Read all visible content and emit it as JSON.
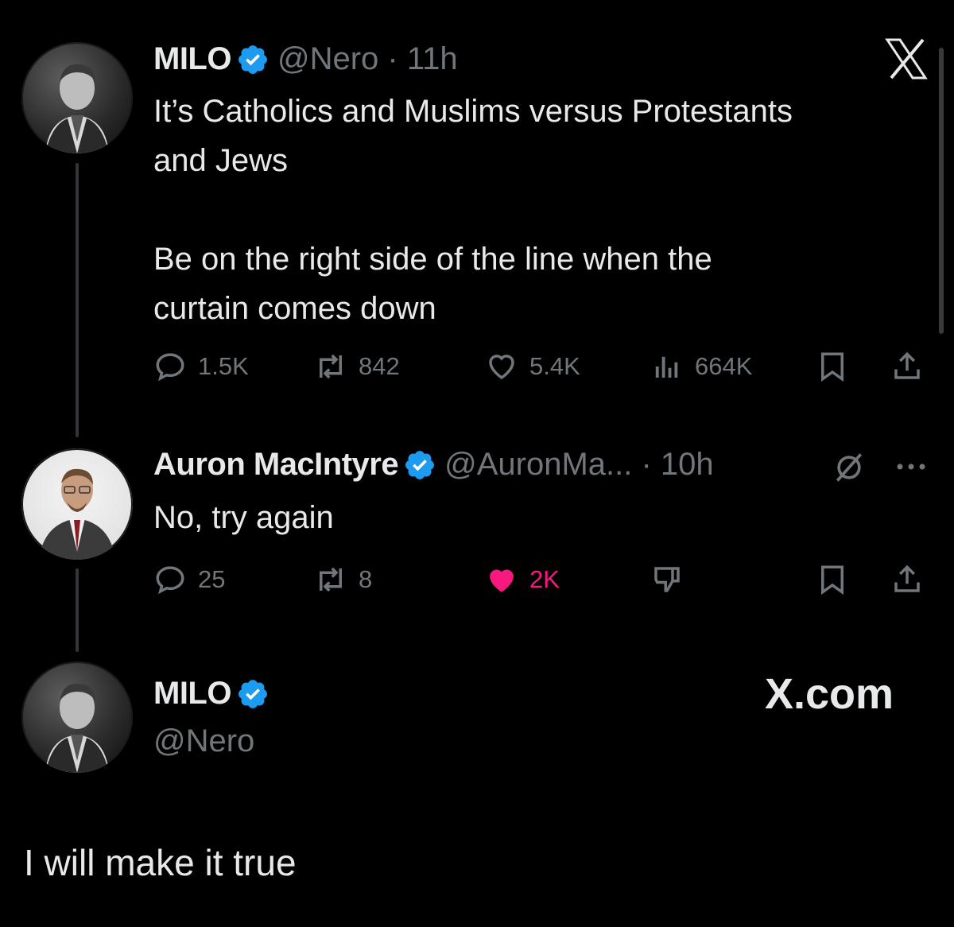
{
  "tweet1": {
    "name": "MILO",
    "handle": "@Nero",
    "time": "11h",
    "text": "It’s Catholics and Muslims versus Protestants\nand Jews\n\nBe on the right side of the line when the\ncurtain comes down",
    "replies": "1.5K",
    "reposts": "842",
    "likes": "5.4K",
    "views": "664K"
  },
  "tweet2": {
    "name": "Auron MacIntyre",
    "handle": "@AuronMa...",
    "time": "10h",
    "text": "No, try again",
    "replies": "25",
    "reposts": "8",
    "likes": "2K"
  },
  "tweet3": {
    "name": "MILO",
    "handle": "@Nero",
    "brand": "X.com",
    "text": "I will make it true"
  },
  "colors": {
    "background": "#000000",
    "text": "#e7e9ea",
    "muted": "#71767b",
    "verified": "#1d9bf0",
    "like": "#f91880"
  }
}
